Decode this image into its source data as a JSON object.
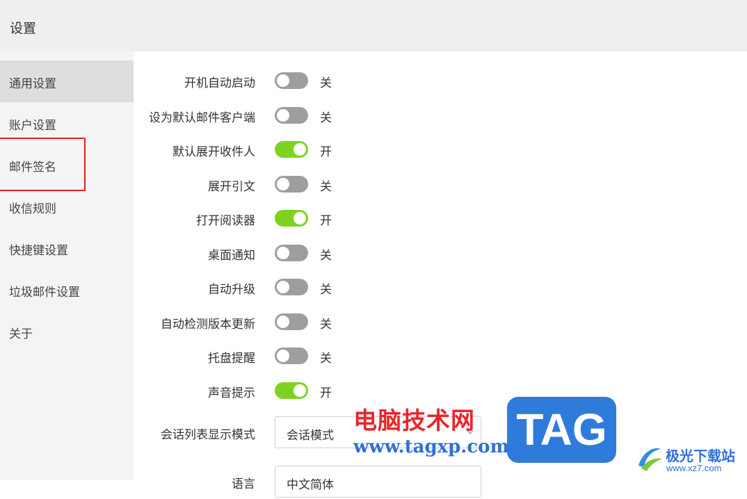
{
  "header": {
    "title": "设置"
  },
  "sidebar": {
    "items": [
      {
        "label": "通用设置",
        "active": true
      },
      {
        "label": "账户设置",
        "active": false
      },
      {
        "label": "邮件签名",
        "active": false,
        "highlighted": true
      },
      {
        "label": "收信规则",
        "active": false
      },
      {
        "label": "快捷键设置",
        "active": false
      },
      {
        "label": "垃圾邮件设置",
        "active": false
      },
      {
        "label": "关于",
        "active": false
      }
    ]
  },
  "settings": {
    "toggles": [
      {
        "label": "开机自动启动",
        "on": false,
        "state": "关"
      },
      {
        "label": "设为默认邮件客户端",
        "on": false,
        "state": "关"
      },
      {
        "label": "默认展开收件人",
        "on": true,
        "state": "开"
      },
      {
        "label": "展开引文",
        "on": false,
        "state": "关"
      },
      {
        "label": "打开阅读器",
        "on": true,
        "state": "开"
      },
      {
        "label": "桌面通知",
        "on": false,
        "state": "关"
      },
      {
        "label": "自动升级",
        "on": false,
        "state": "关"
      },
      {
        "label": "自动检测版本更新",
        "on": false,
        "state": "关"
      },
      {
        "label": "托盘提醒",
        "on": false,
        "state": "关"
      },
      {
        "label": "声音提示",
        "on": true,
        "state": "开"
      }
    ],
    "selects": [
      {
        "label": "会话列表显示模式",
        "value": "会话模式"
      },
      {
        "label": "语言",
        "value": "中文简体"
      }
    ]
  },
  "colors": {
    "toggle_on": "#7ed321",
    "toggle_off": "#9e9e9e",
    "highlight": "#e02020"
  },
  "watermark": {
    "cn_text": "电脑技术网",
    "url": "www.tagxp.com",
    "tag": "TAG",
    "site_name": "极光下载站",
    "site_url": "www.xz7.com"
  }
}
